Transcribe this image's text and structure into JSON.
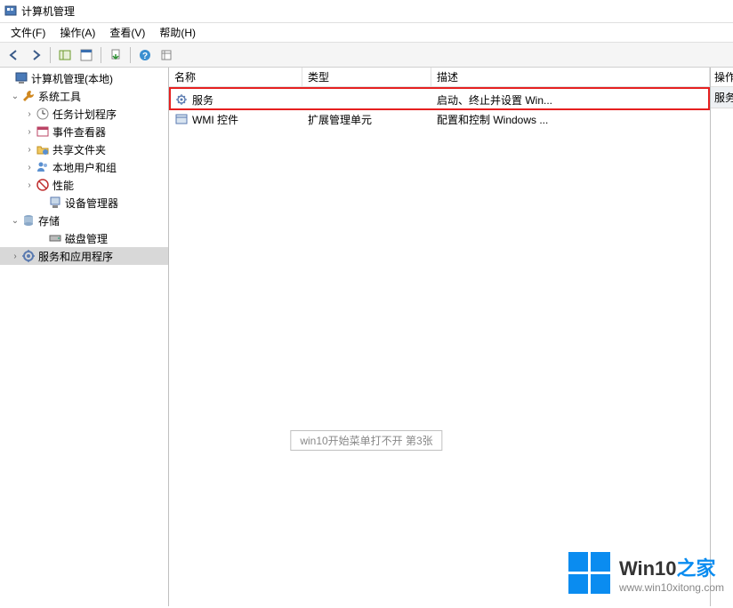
{
  "window": {
    "title": "计算机管理"
  },
  "menubar": {
    "file": "文件(F)",
    "action": "操作(A)",
    "view": "查看(V)",
    "help": "帮助(H)"
  },
  "tree": {
    "root": "计算机管理(本地)",
    "systemTools": "系统工具",
    "taskScheduler": "任务计划程序",
    "eventViewer": "事件查看器",
    "sharedFolders": "共享文件夹",
    "localUsers": "本地用户和组",
    "performance": "性能",
    "deviceManager": "设备管理器",
    "storage": "存储",
    "diskManagement": "磁盘管理",
    "servicesApps": "服务和应用程序"
  },
  "list": {
    "headers": {
      "name": "名称",
      "type": "类型",
      "desc": "描述"
    },
    "rows": [
      {
        "name": "服务",
        "type": "",
        "desc": "启动、终止并设置 Win..."
      },
      {
        "name": "WMI 控件",
        "type": "扩展管理单元",
        "desc": "配置和控制 Windows ..."
      }
    ]
  },
  "actionPane": {
    "header": "操作",
    "item": "服务"
  },
  "watermark": "win10开始菜单打不开 第3张",
  "branding": {
    "textMain": "Win10",
    "textAccent": "之家",
    "url": "www.win10xitong.com"
  }
}
